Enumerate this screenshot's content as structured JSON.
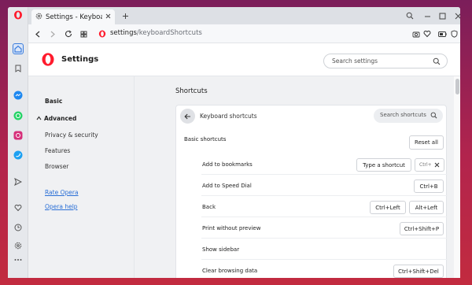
{
  "browser": {
    "tab_title": "Settings - Keyboard s",
    "url_host": "settings",
    "url_path": "/keyboardShortcuts"
  },
  "sidebar": {
    "items": [
      "home-icon",
      "bookmark-icon",
      "messenger-icon",
      "whatsapp-icon",
      "instagram-icon",
      "twitter-icon",
      "send-icon",
      "heart-icon",
      "history-icon",
      "settings-icon",
      "more-icon"
    ]
  },
  "header": {
    "title": "Settings",
    "search_placeholder": "Search settings"
  },
  "nav": {
    "basic": "Basic",
    "advanced": "Advanced",
    "privacy": "Privacy & security",
    "features": "Features",
    "browser": "Browser",
    "rate": "Rate Opera",
    "help": "Opera help"
  },
  "content": {
    "section_title": "Shortcuts",
    "card_title": "Keyboard shortcuts",
    "search_placeholder": "Search shortcuts",
    "basic_shortcuts": "Basic shortcuts",
    "reset_all": "Reset all",
    "rows": [
      {
        "label": "Add to bookmarks",
        "keys": [
          "Type a shortcut",
          "Ctrl+"
        ]
      },
      {
        "label": "Add to Speed Dial",
        "keys": [
          "Ctrl+B"
        ]
      },
      {
        "label": "Back",
        "keys": [
          "Ctrl+Left",
          "Alt+Left"
        ]
      },
      {
        "label": "Print without preview",
        "keys": [
          "Ctrl+Shift+P"
        ]
      },
      {
        "label": "Show sidebar",
        "keys": []
      },
      {
        "label": "Clear browsing data",
        "keys": [
          "Ctrl+Shift+Del"
        ]
      }
    ]
  },
  "colors": {
    "opera_red": "#ff1b2d",
    "link": "#2a6fd6",
    "sidebar_active": "#3b7ddd"
  }
}
